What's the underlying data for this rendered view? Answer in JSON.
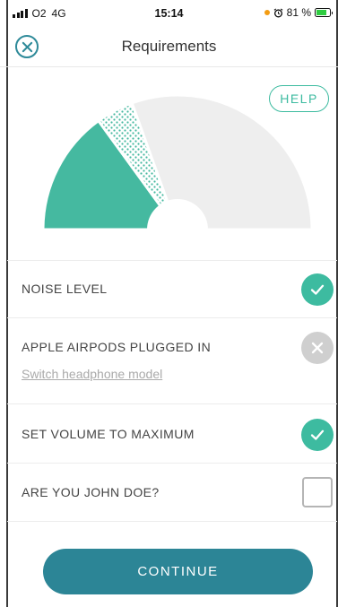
{
  "status_bar": {
    "carrier": "O2",
    "network": "4G",
    "time": "15:14",
    "battery_percent": "81 %",
    "battery_level": 0.81
  },
  "header": {
    "title": "Requirements",
    "close_icon": "close-circle-icon"
  },
  "gauge": {
    "help_label": "HELP",
    "segments": [
      {
        "name": "filled",
        "color": "#45b9a0",
        "fraction": 0.3
      },
      {
        "name": "dotted",
        "color": "#45b9a0",
        "fraction": 0.09
      },
      {
        "name": "empty",
        "color": "#eeeeee",
        "fraction": 0.61
      }
    ]
  },
  "requirements": [
    {
      "label": "NOISE LEVEL",
      "status": "ok",
      "icon": "check-icon"
    },
    {
      "label": "APPLE AIRPODS PLUGGED IN",
      "status": "fail",
      "icon": "x-icon",
      "link": "Switch headphone model"
    },
    {
      "label": "SET VOLUME TO MAXIMUM",
      "status": "ok",
      "icon": "check-icon"
    },
    {
      "label": "ARE YOU JOHN DOE?",
      "status": "checkbox",
      "icon": "checkbox-icon",
      "checked": false
    }
  ],
  "continue_label": "CONTINUE",
  "colors": {
    "accent": "#3dbba0",
    "primary": "#2c8596",
    "inactive": "#cfcfcf"
  }
}
